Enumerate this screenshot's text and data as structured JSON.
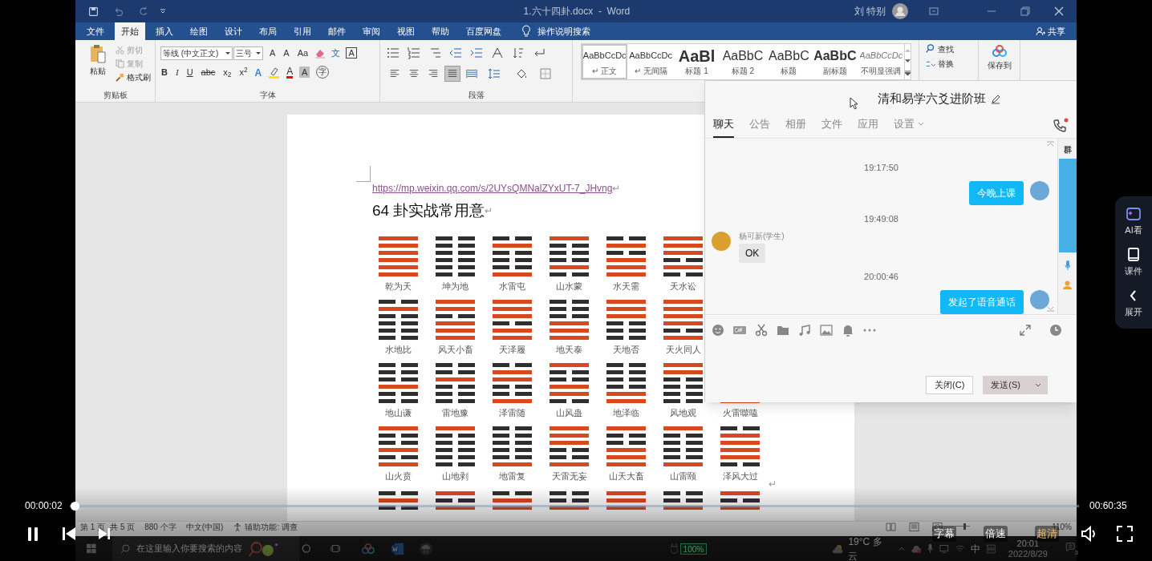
{
  "word": {
    "title": "1.六十四卦.docx  -  Word",
    "user": "刘 特别",
    "tabs": [
      {
        "label": "文件",
        "selected": false
      },
      {
        "label": "开始",
        "selected": true
      },
      {
        "label": "插入",
        "selected": false
      },
      {
        "label": "绘图",
        "selected": false
      },
      {
        "label": "设计",
        "selected": false
      },
      {
        "label": "布局",
        "selected": false
      },
      {
        "label": "引用",
        "selected": false
      },
      {
        "label": "邮件",
        "selected": false
      },
      {
        "label": "审阅",
        "selected": false
      },
      {
        "label": "视图",
        "selected": false
      },
      {
        "label": "帮助",
        "selected": false
      },
      {
        "label": "百度网盘",
        "selected": false
      }
    ],
    "tell_me": "操作说明搜索",
    "share": "共享",
    "clipboard": {
      "paste": "粘贴",
      "cut": "剪切",
      "copy": "复制",
      "format_painter": "格式刷",
      "group_label": "剪贴板"
    },
    "font": {
      "name": "等线 (中文正文)",
      "size": "三号",
      "tools": [
        {
          "kind": "grow",
          "label": "A"
        },
        {
          "kind": "shrink",
          "label": "A"
        },
        {
          "kind": "case",
          "label": "Aa"
        },
        {
          "kind": "clear"
        },
        {
          "kind": "phonetic",
          "label": "文"
        },
        {
          "kind": "border",
          "label": "A"
        }
      ],
      "formats": [
        {
          "kind": "bold",
          "label": "B"
        },
        {
          "kind": "italic",
          "label": "I"
        },
        {
          "kind": "underline",
          "label": "U"
        },
        {
          "kind": "strike",
          "label": "abc"
        },
        {
          "kind": "sub",
          "label": "x$_{2}$"
        },
        {
          "kind": "sup",
          "label": "x$^{2}$"
        }
      ],
      "effects": [
        {
          "kind": "effect",
          "label": "A"
        },
        {
          "kind": "highlight"
        },
        {
          "kind": "color",
          "label": "A"
        },
        {
          "kind": "shading",
          "label": "A"
        },
        {
          "kind": "enclose",
          "label": "字"
        }
      ],
      "group_label": "字体"
    },
    "paragraph": {
      "alignment": [
        {
          "kind": "left",
          "selected": false
        },
        {
          "kind": "center",
          "selected": false
        },
        {
          "kind": "right",
          "selected": false
        },
        {
          "kind": "justify",
          "selected": true
        },
        {
          "kind": "distributed",
          "selected": false
        }
      ],
      "group_label": "段落"
    },
    "styles": [
      {
        "kind": "normal",
        "sample": "AaBbCcDc",
        "name": "↵ 正文",
        "selected": true
      },
      {
        "kind": "normal",
        "sample": "AaBbCcDc",
        "name": "↵ 无间隔",
        "selected": false
      },
      {
        "kind": "heading1",
        "sample": "AaBl",
        "name": "标题 1",
        "selected": false
      },
      {
        "kind": "heading2",
        "sample": "AaBbC",
        "name": "标题 2",
        "selected": false
      },
      {
        "kind": "title",
        "sample": "AaBbC",
        "name": "标题",
        "selected": false
      },
      {
        "kind": "subtitle",
        "sample": "AaBbC",
        "name": "副标题",
        "selected": false
      },
      {
        "kind": "emphasis",
        "sample": "AaBbCcDc",
        "name": "不明显强调",
        "selected": false
      }
    ],
    "editing": [
      "查找",
      "替换"
    ],
    "baidu_save": [
      "保存到"
    ]
  },
  "document": {
    "link": "https://mp.weixin.qq.com/s/2UYsQMNalZYxUT-7_JHvng",
    "link_mark": "↵",
    "heading": "64 卦实战常用意",
    "heading_mark": "↵",
    "end_mark": "↵",
    "rows": [
      [
        {
          "name": "乾为天",
          "lines": [
            {
              "solid": true
            },
            {
              "solid": true
            },
            {
              "solid": true
            },
            {
              "solid": true
            },
            {
              "solid": true
            },
            {
              "solid": true
            }
          ]
        },
        {
          "name": "坤为地",
          "lines": [
            {
              "solid": false
            },
            {
              "solid": false
            },
            {
              "solid": false
            },
            {
              "solid": false
            },
            {
              "solid": false
            },
            {
              "solid": false
            }
          ]
        },
        {
          "name": "水雷屯",
          "lines": [
            {
              "solid": false
            },
            {
              "solid": true
            },
            {
              "solid": false
            },
            {
              "solid": false
            },
            {
              "solid": false
            },
            {
              "solid": true
            }
          ]
        },
        {
          "name": "山水蒙",
          "lines": [
            {
              "solid": true
            },
            {
              "solid": false
            },
            {
              "solid": false
            },
            {
              "solid": false
            },
            {
              "solid": true
            },
            {
              "solid": false
            }
          ]
        },
        {
          "name": "水天需",
          "lines": [
            {
              "solid": false
            },
            {
              "solid": true
            },
            {
              "solid": false
            },
            {
              "solid": true
            },
            {
              "solid": true
            },
            {
              "solid": true
            }
          ]
        },
        {
          "name": "天水讼",
          "lines": [
            {
              "solid": true
            },
            {
              "solid": true
            },
            {
              "solid": true
            },
            {
              "solid": false
            },
            {
              "solid": true
            },
            {
              "solid": false
            }
          ]
        }
      ],
      [
        {
          "name": "水地比",
          "lines": [
            {
              "solid": false
            },
            {
              "solid": true
            },
            {
              "solid": false
            },
            {
              "solid": false
            },
            {
              "solid": false
            },
            {
              "solid": false
            }
          ]
        },
        {
          "name": "风天小畜",
          "lines": [
            {
              "solid": true
            },
            {
              "solid": true
            },
            {
              "solid": false
            },
            {
              "solid": true
            },
            {
              "solid": true
            },
            {
              "solid": true
            }
          ]
        },
        {
          "name": "天泽履",
          "lines": [
            {
              "solid": true
            },
            {
              "solid": true
            },
            {
              "solid": true
            },
            {
              "solid": false
            },
            {
              "solid": true
            },
            {
              "solid": true
            }
          ]
        },
        {
          "name": "地天泰",
          "lines": [
            {
              "solid": false
            },
            {
              "solid": false
            },
            {
              "solid": false
            },
            {
              "solid": true
            },
            {
              "solid": true
            },
            {
              "solid": true
            }
          ]
        },
        {
          "name": "天地否",
          "lines": [
            {
              "solid": true
            },
            {
              "solid": true
            },
            {
              "solid": true
            },
            {
              "solid": false
            },
            {
              "solid": false
            },
            {
              "solid": false
            }
          ]
        },
        {
          "name": "天火同人",
          "lines": [
            {
              "solid": true
            },
            {
              "solid": true
            },
            {
              "solid": true
            },
            {
              "solid": true
            },
            {
              "solid": false
            },
            {
              "solid": true
            }
          ]
        }
      ],
      [
        {
          "name": "地山谦",
          "lines": [
            {
              "solid": false
            },
            {
              "solid": false
            },
            {
              "solid": false
            },
            {
              "solid": true
            },
            {
              "solid": false
            },
            {
              "solid": false
            }
          ]
        },
        {
          "name": "雷地豫",
          "lines": [
            {
              "solid": false
            },
            {
              "solid": false
            },
            {
              "solid": true
            },
            {
              "solid": false
            },
            {
              "solid": false
            },
            {
              "solid": false
            }
          ]
        },
        {
          "name": "泽雷随",
          "lines": [
            {
              "solid": false
            },
            {
              "solid": true
            },
            {
              "solid": true
            },
            {
              "solid": false
            },
            {
              "solid": false
            },
            {
              "solid": true
            }
          ]
        },
        {
          "name": "山风蛊",
          "lines": [
            {
              "solid": true
            },
            {
              "solid": false
            },
            {
              "solid": false
            },
            {
              "solid": true
            },
            {
              "solid": true
            },
            {
              "solid": false
            }
          ]
        },
        {
          "name": "地泽临",
          "lines": [
            {
              "solid": false
            },
            {
              "solid": false
            },
            {
              "solid": false
            },
            {
              "solid": false
            },
            {
              "solid": true
            },
            {
              "solid": true
            }
          ]
        },
        {
          "name": "风地观",
          "lines": [
            {
              "solid": true
            },
            {
              "solid": true
            },
            {
              "solid": false
            },
            {
              "solid": false
            },
            {
              "solid": false
            },
            {
              "solid": false
            }
          ]
        },
        {
          "name": "火雷噬嗑",
          "lines": [
            {
              "solid": true
            }
          ]
        }
      ],
      [
        {
          "name": "山火贲",
          "lines": [
            {
              "solid": true
            },
            {
              "solid": false
            },
            {
              "solid": false
            },
            {
              "solid": true
            },
            {
              "solid": false
            },
            {
              "solid": true
            }
          ]
        },
        {
          "name": "山地剥",
          "lines": [
            {
              "solid": true
            },
            {
              "solid": false
            },
            {
              "solid": false
            },
            {
              "solid": false
            },
            {
              "solid": false
            },
            {
              "solid": false
            }
          ]
        },
        {
          "name": "地雷复",
          "lines": [
            {
              "solid": false
            },
            {
              "solid": false
            },
            {
              "solid": false
            },
            {
              "solid": false
            },
            {
              "solid": false
            },
            {
              "solid": true
            }
          ]
        },
        {
          "name": "天雷无妄",
          "lines": [
            {
              "solid": true
            },
            {
              "solid": true
            },
            {
              "solid": true
            },
            {
              "solid": false
            },
            {
              "solid": false
            },
            {
              "solid": true
            }
          ]
        },
        {
          "name": "山天大畜",
          "lines": [
            {
              "solid": true
            },
            {
              "solid": false
            },
            {
              "solid": false
            },
            {
              "solid": true
            },
            {
              "solid": true
            },
            {
              "solid": true
            }
          ]
        },
        {
          "name": "山雷颐",
          "lines": [
            {
              "solid": true
            },
            {
              "solid": false
            },
            {
              "solid": false
            },
            {
              "solid": false
            },
            {
              "solid": false
            },
            {
              "solid": true
            }
          ]
        },
        {
          "name": "泽风大过",
          "lines": [
            {
              "solid": false
            },
            {
              "solid": true
            },
            {
              "solid": true
            },
            {
              "solid": true
            },
            {
              "solid": true
            },
            {
              "solid": false
            }
          ]
        }
      ],
      [
        {
          "lines": [
            {
              "solid": false
            },
            {
              "solid": true
            },
            {
              "solid": false
            }
          ]
        },
        {
          "lines": [
            {
              "solid": true
            },
            {
              "solid": false
            },
            {
              "solid": true
            }
          ]
        },
        {
          "lines": [
            {
              "solid": false
            },
            {
              "solid": true
            },
            {
              "solid": true
            }
          ]
        },
        {
          "lines": [
            {
              "solid": false
            },
            {
              "solid": false
            },
            {
              "solid": true
            }
          ]
        },
        {
          "lines": [
            {
              "solid": true
            },
            {
              "solid": true
            },
            {
              "solid": true
            }
          ]
        },
        {
          "lines": [
            {
              "solid": false
            },
            {
              "solid": false
            },
            {
              "solid": true
            }
          ]
        },
        {
          "lines": [
            {
              "solid": true
            },
            {
              "solid": false
            },
            {
              "solid": true
            }
          ]
        }
      ]
    ]
  },
  "status_bar": {
    "page": "第 1 页",
    "pages": "共 5 页",
    "words": "880 个字",
    "language": "中文(中国)",
    "accessibility": "辅助功能: 调查",
    "zoom_slider": {
      "level": 0.55
    },
    "zoom": "110%"
  },
  "taskbar": {
    "search_placeholder": "在这里输入你要搜索的内容",
    "battery": "100%",
    "weather": "19°C 多云",
    "ime": "中",
    "time": "20:01",
    "date": "2022/8/29",
    "notifications": "3"
  },
  "chat": {
    "title": "清和易学六爻进阶班",
    "tabs": [
      {
        "label": "聊天",
        "selected": true
      },
      {
        "label": "公告",
        "selected": false
      },
      {
        "label": "相册",
        "selected": false
      },
      {
        "label": "文件",
        "selected": false
      },
      {
        "label": "应用",
        "selected": false
      },
      {
        "label": "设置",
        "selected": false
      }
    ],
    "messages": [
      {
        "kind": "time",
        "text": "19:17:50"
      },
      {
        "kind": "outgoing",
        "text": "今晚上课"
      },
      {
        "kind": "time",
        "text": "19:49:08"
      },
      {
        "kind": "incoming",
        "sender": "杨可新(学生)",
        "text": "OK"
      },
      {
        "kind": "time",
        "text": "20:00:46"
      },
      {
        "kind": "outgoing",
        "text": "发起了语音通话"
      }
    ],
    "side_label": "群",
    "close_button": "关闭(C)",
    "send_button": "发送(S)"
  },
  "side_panel": [
    {
      "kind": "ai",
      "label": "AI看"
    },
    {
      "kind": "courseware",
      "label": "课件"
    },
    {
      "kind": "expand",
      "label": "展开"
    }
  ],
  "player": {
    "current_time": "00:00:02",
    "total_time": "00:60:35",
    "level": 0.001,
    "options": [
      {
        "label": "字幕",
        "selected": false
      },
      {
        "label": "倍速",
        "selected": false
      },
      {
        "label": "超清",
        "selected": true
      }
    ]
  }
}
